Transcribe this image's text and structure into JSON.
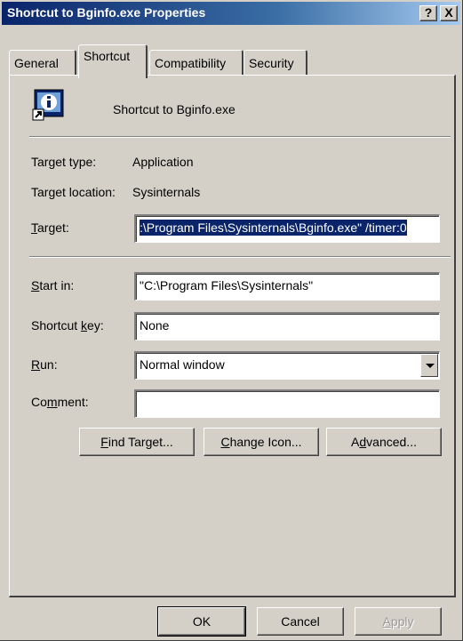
{
  "window": {
    "title": "Shortcut to Bginfo.exe Properties",
    "help_btn": "?",
    "close_btn": "X"
  },
  "tabs": [
    {
      "label": "General",
      "active": false
    },
    {
      "label": "Shortcut",
      "active": true
    },
    {
      "label": "Compatibility",
      "active": false
    },
    {
      "label": "Security",
      "active": false
    }
  ],
  "shortcut": {
    "name": "Shortcut to Bginfo.exe",
    "icon": "bginfo-shortcut-icon",
    "target_type_label": "Target type:",
    "target_type_value": "Application",
    "target_location_label": "Target location:",
    "target_location_value": "Sysinternals",
    "target_label_pre": "",
    "target_label_u": "T",
    "target_label_post": "arget:",
    "target_value": ":\\Program Files\\Sysinternals\\Bginfo.exe\" /timer:0",
    "start_in_label_u": "S",
    "start_in_label_post": "tart in:",
    "start_in_value": "\"C:\\Program Files\\Sysinternals\"",
    "shortcut_key_label_pre": "Shortcut ",
    "shortcut_key_label_u": "k",
    "shortcut_key_label_post": "ey:",
    "shortcut_key_value": "None",
    "run_label_u": "R",
    "run_label_post": "un:",
    "run_value": "Normal window",
    "comment_label_pre": "Co",
    "comment_label_u": "m",
    "comment_label_post": "ment:",
    "comment_value": ""
  },
  "actions": {
    "find_target_u": "F",
    "find_target_post": "ind Target...",
    "change_icon_u": "C",
    "change_icon_post": "hange Icon...",
    "advanced_pre": "A",
    "advanced_u": "d",
    "advanced_post": "vanced..."
  },
  "footer": {
    "ok": "OK",
    "cancel": "Cancel",
    "apply_u": "A",
    "apply_post": "pply"
  }
}
